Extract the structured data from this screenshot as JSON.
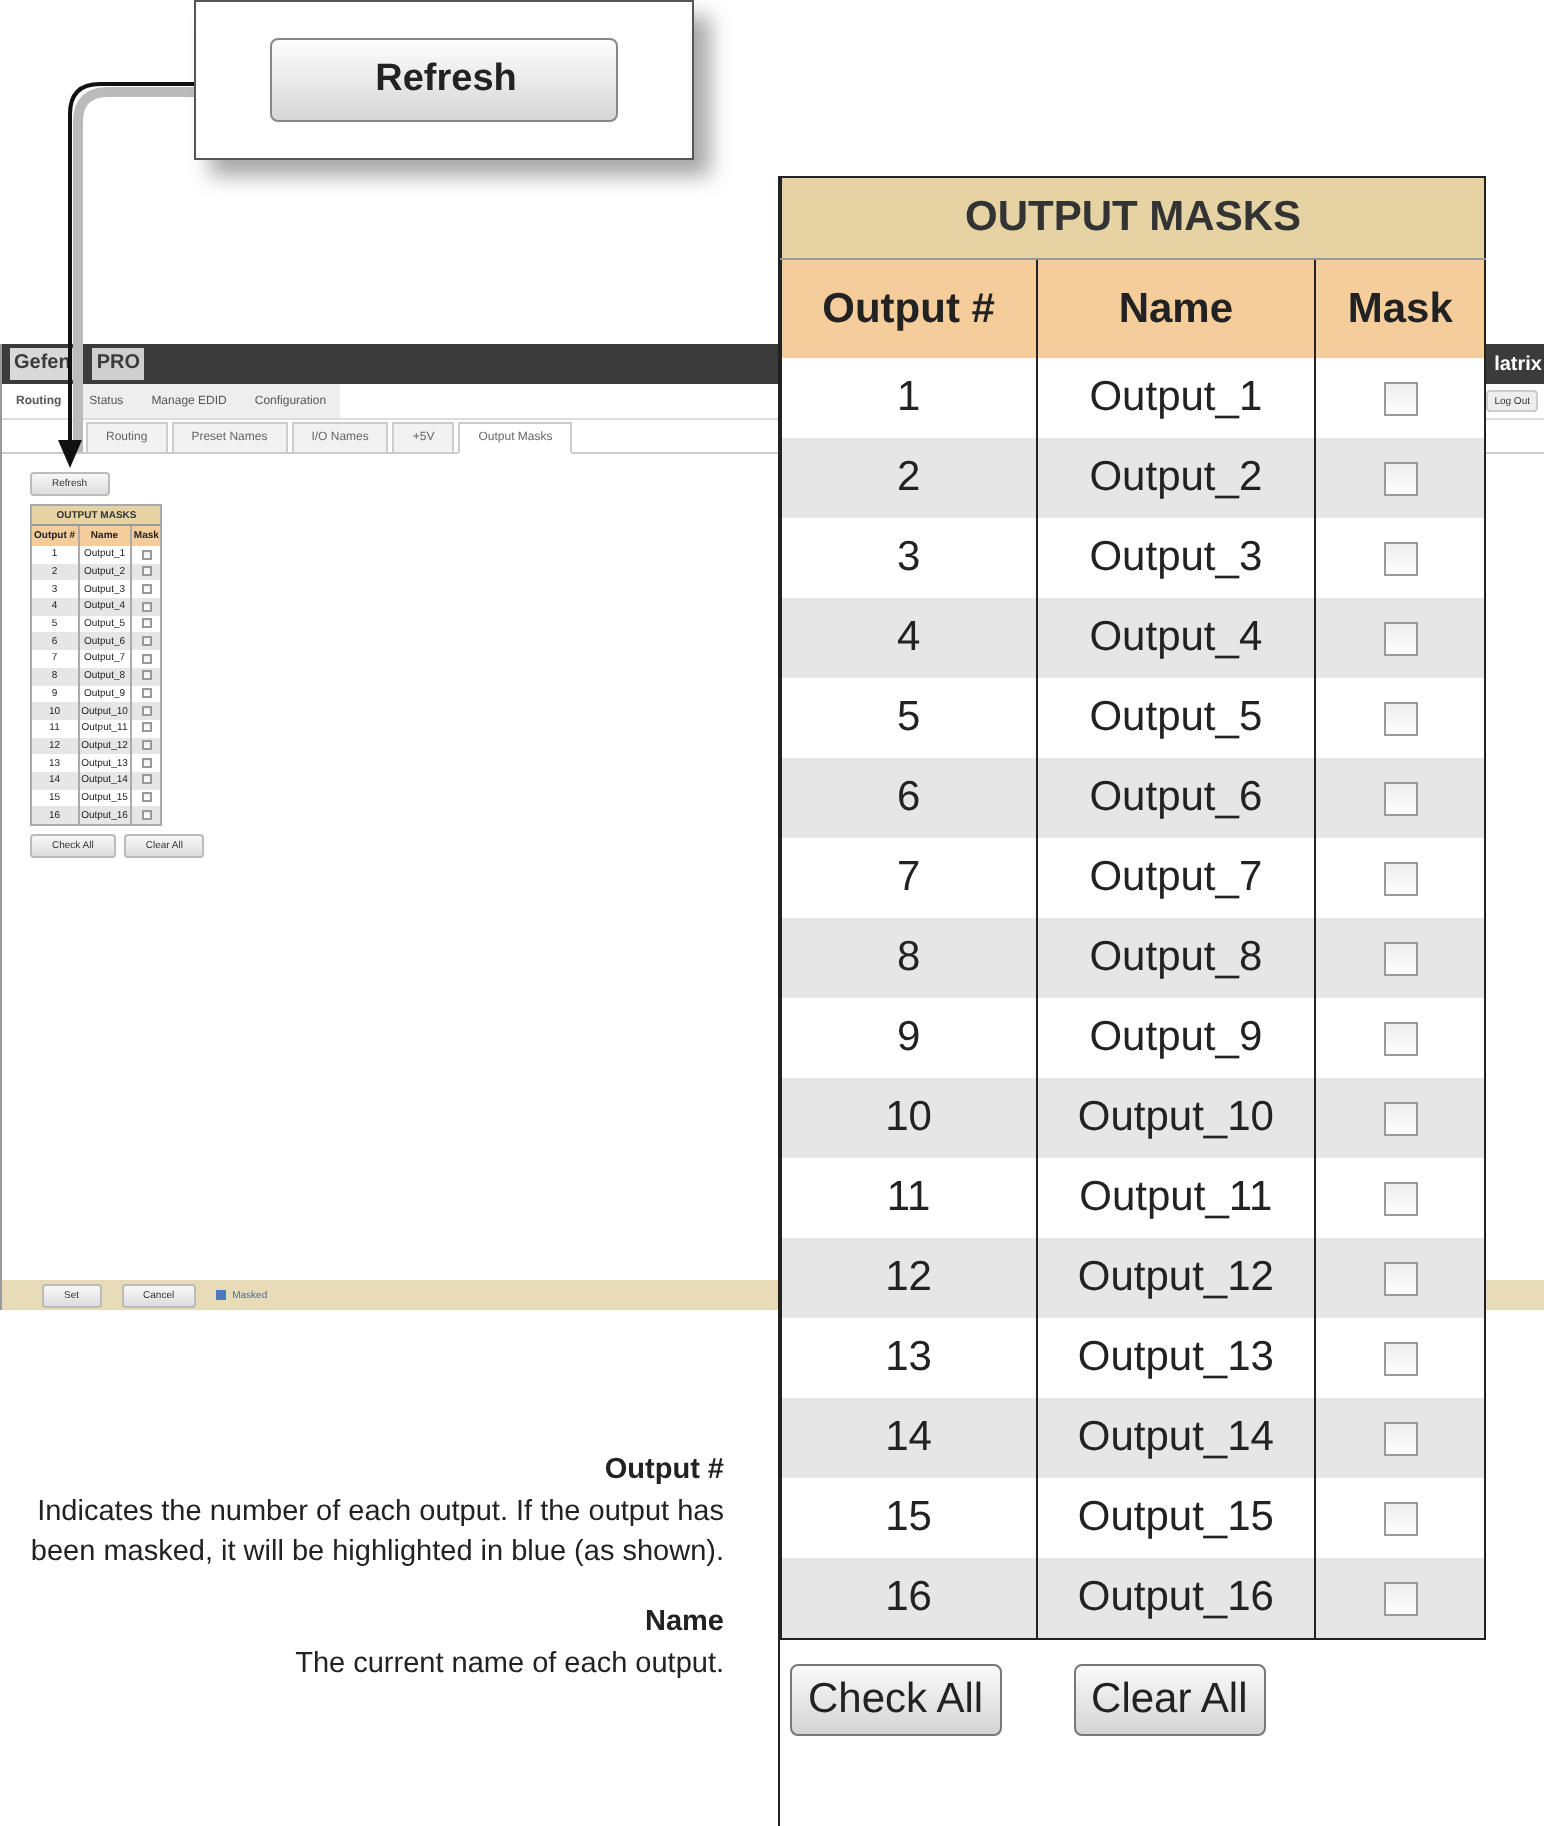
{
  "callout": {
    "button": "Refresh"
  },
  "app": {
    "logo": {
      "part_1": "Gefen",
      "part_2": "PRO"
    },
    "header_text": "latrix",
    "logout": "Log Out",
    "menu": [
      {
        "label": "Routing",
        "selected": true
      },
      {
        "label": "Status",
        "selected": false
      },
      {
        "label": "Manage EDID",
        "selected": false
      },
      {
        "label": "Configuration",
        "selected": false
      }
    ],
    "subtabs": [
      {
        "label": "Routing",
        "selected": false
      },
      {
        "label": "Preset Names",
        "selected": false
      },
      {
        "label": "I/O Names",
        "selected": false
      },
      {
        "label": "+5V",
        "selected": false
      },
      {
        "label": "Output Masks",
        "selected": true
      }
    ],
    "refresh": "Refresh",
    "table": {
      "title": "OUTPUT MASKS",
      "columns": [
        "Output #",
        "Name",
        "Mask"
      ],
      "rows": [
        {
          "number": "1",
          "name": "Output_1",
          "checked": false
        },
        {
          "number": "2",
          "name": "Output_2",
          "checked": false
        },
        {
          "number": "3",
          "name": "Output_3",
          "checked": false
        },
        {
          "number": "4",
          "name": "Output_4",
          "checked": false
        },
        {
          "number": "5",
          "name": "Output_5",
          "checked": false
        },
        {
          "number": "6",
          "name": "Output_6",
          "checked": false
        },
        {
          "number": "7",
          "name": "Output_7",
          "checked": false
        },
        {
          "number": "8",
          "name": "Output_8",
          "checked": false
        },
        {
          "number": "9",
          "name": "Output_9",
          "checked": false
        },
        {
          "number": "10",
          "name": "Output_10",
          "checked": false
        },
        {
          "number": "11",
          "name": "Output_11",
          "checked": false
        },
        {
          "number": "12",
          "name": "Output_12",
          "checked": false
        },
        {
          "number": "13",
          "name": "Output_13",
          "checked": false
        },
        {
          "number": "14",
          "name": "Output_14",
          "checked": false
        },
        {
          "number": "15",
          "name": "Output_15",
          "checked": false
        },
        {
          "number": "16",
          "name": "Output_16",
          "checked": false
        }
      ],
      "buttons": [
        "Check All",
        "Clear All"
      ]
    },
    "footer": {
      "buttons": [
        "Set",
        "Cancel"
      ],
      "legend": "Masked"
    }
  },
  "zoom_panel": {
    "title": "OUTPUT MASKS",
    "columns": [
      "Output #",
      "Name",
      "Mask"
    ],
    "rows": [
      {
        "number": "1",
        "name": "Output_1",
        "checked": false
      },
      {
        "number": "2",
        "name": "Output_2",
        "checked": false
      },
      {
        "number": "3",
        "name": "Output_3",
        "checked": false
      },
      {
        "number": "4",
        "name": "Output_4",
        "checked": false
      },
      {
        "number": "5",
        "name": "Output_5",
        "checked": false
      },
      {
        "number": "6",
        "name": "Output_6",
        "checked": false
      },
      {
        "number": "7",
        "name": "Output_7",
        "checked": false
      },
      {
        "number": "8",
        "name": "Output_8",
        "checked": false
      },
      {
        "number": "9",
        "name": "Output_9",
        "checked": false
      },
      {
        "number": "10",
        "name": "Output_10",
        "checked": false
      },
      {
        "number": "11",
        "name": "Output_11",
        "checked": false
      },
      {
        "number": "12",
        "name": "Output_12",
        "checked": false
      },
      {
        "number": "13",
        "name": "Output_13",
        "checked": false
      },
      {
        "number": "14",
        "name": "Output_14",
        "checked": false
      },
      {
        "number": "15",
        "name": "Output_15",
        "checked": false
      },
      {
        "number": "16",
        "name": "Output_16",
        "checked": false
      }
    ],
    "buttons": [
      "Check All",
      "Clear All"
    ]
  },
  "notes": [
    {
      "heading": "Output #",
      "text": "Indicates the number of each output. If the output has been masked, it will be highlighted in blue (as shown)."
    },
    {
      "heading": "Name",
      "text": "The current name of each output."
    }
  ]
}
